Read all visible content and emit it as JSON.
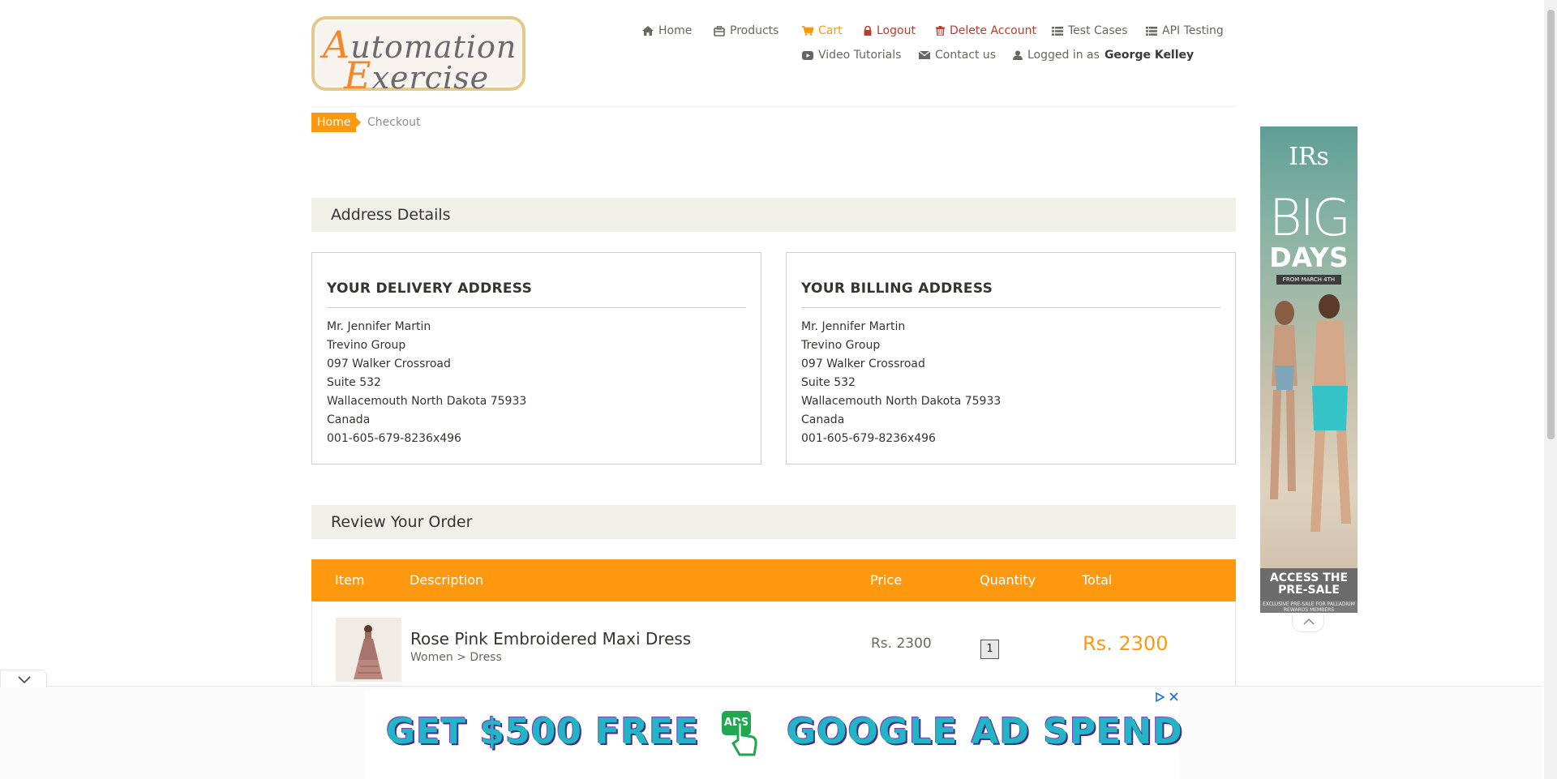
{
  "logo": {
    "line1_cap": "A",
    "line1_rest": "utomation",
    "line2_cap": "E",
    "line2_rest": "xercise"
  },
  "nav": {
    "home": "Home",
    "products": "Products",
    "cart": "Cart",
    "logout": "Logout",
    "delete_account": "Delete Account",
    "test_cases": "Test Cases",
    "api_testing": "API Testing",
    "video_tutorials": "Video Tutorials",
    "contact_us": "Contact us",
    "logged_in_prefix": "Logged in as",
    "username": "George Kelley"
  },
  "breadcrumb": {
    "home": "Home",
    "current": "Checkout"
  },
  "address_details": {
    "heading": "Address Details",
    "delivery": {
      "title": "YOUR DELIVERY ADDRESS",
      "lines": [
        "Mr. Jennifer Martin",
        "Trevino Group",
        "097 Walker Crossroad",
        "Suite 532",
        "Wallacemouth North Dakota 75933",
        "Canada",
        "001-605-679-8236x496"
      ]
    },
    "billing": {
      "title": "YOUR BILLING ADDRESS",
      "lines": [
        "Mr. Jennifer Martin",
        "Trevino Group",
        "097 Walker Crossroad",
        "Suite 532",
        "Wallacemouth North Dakota 75933",
        "Canada",
        "001-605-679-8236x496"
      ]
    }
  },
  "review": {
    "heading": "Review Your Order",
    "columns": {
      "item": "Item",
      "description": "Description",
      "price": "Price",
      "quantity": "Quantity",
      "total": "Total"
    },
    "rows": [
      {
        "name": "Rose Pink Embroidered Maxi Dress",
        "category": "Women > Dress",
        "price": "Rs. 2300",
        "quantity": "1",
        "total": "Rs. 2300"
      }
    ]
  },
  "side_ad": {
    "brand": "IRs",
    "big": "BIG",
    "days": "DAYS",
    "from": "FROM MARCH 4TH",
    "cta": "ACCESS THE PRE-SALE",
    "fine_print": "EXCLUSIVE PRE-SALE FOR PALLADIUM REWARDS MEMBERS"
  },
  "bottom_ad": {
    "left_text": "GET $500 FREE",
    "badge": "ADS",
    "right_text": "GOOGLE AD SPEND"
  },
  "colors": {
    "accent": "#fe980f",
    "danger": "#c0392b",
    "section_bg": "#f0efe8",
    "ad_cyan": "#21b5c5"
  }
}
